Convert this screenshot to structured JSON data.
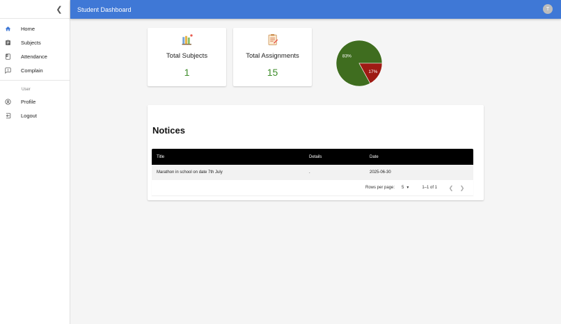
{
  "topbar": {
    "title": "Student Dashboard",
    "avatar_letter": "T",
    "color": "#3f78d6"
  },
  "sidebar": {
    "collapse_icon": "chevron-left-icon",
    "items": [
      {
        "label": "Home",
        "icon": "home-icon"
      },
      {
        "label": "Subjects",
        "icon": "clipboard-icon"
      },
      {
        "label": "Attendance",
        "icon": "book-icon"
      },
      {
        "label": "Complain",
        "icon": "feedback-icon"
      }
    ],
    "user_section": "User",
    "user_items": [
      {
        "label": "Profile",
        "icon": "account-circle-icon"
      },
      {
        "label": "Logout",
        "icon": "logout-icon"
      }
    ]
  },
  "stats": {
    "subjects": {
      "label": "Total Subjects",
      "value": "1",
      "icon": "books-icon"
    },
    "assignments": {
      "label": "Total Assignments",
      "value": "15",
      "icon": "assignment-icon"
    }
  },
  "chart_data": {
    "type": "pie",
    "slices": [
      {
        "label": "83%",
        "value": 83,
        "color": "#3f6d1f"
      },
      {
        "label": "17%",
        "value": 17,
        "color": "#9e1b14"
      }
    ]
  },
  "notices": {
    "heading": "Notices",
    "columns": [
      "Title",
      "Details",
      "Date"
    ],
    "rows": [
      {
        "title": "Marathon in school on date 7th July",
        "details": ".",
        "date": "2025-06-30"
      }
    ],
    "pagination": {
      "rows_per_page_label": "Rows per page:",
      "rows_per_page": "5",
      "range": "1–1 of 1"
    }
  }
}
